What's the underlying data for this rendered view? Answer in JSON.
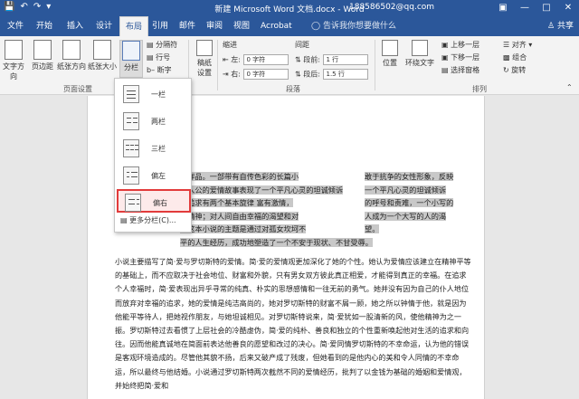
{
  "titlebar": {
    "title": "新建 Microsoft Word 文档.docx - Word",
    "account": "188586502@qq.com",
    "save_icon": "save-icon",
    "undo_icon": "undo-icon",
    "redo_icon": "redo-icon"
  },
  "tabs": [
    "文件",
    "开始",
    "插入",
    "设计",
    "布局",
    "引用",
    "邮件",
    "审阅",
    "视图",
    "Acrobat"
  ],
  "tab_active": "布局",
  "tellme": "告诉我你想要做什么",
  "share": "共享",
  "ribbon": {
    "page_setup": {
      "group_label": "页面设置",
      "text_direction": "文字方向",
      "margins": "页边距",
      "orientation": "纸张方向",
      "size": "纸张大小",
      "columns": "分栏",
      "breaks": "分隔符",
      "line_numbers": "行号",
      "hyphenation": "断字"
    },
    "manuscript": {
      "label": "稿纸设置",
      "line1": "稿纸",
      "line2": "设置"
    },
    "paragraph": {
      "group_label": "段落",
      "indent": "缩进",
      "spacing": "间距",
      "left": "左:",
      "right": "右:",
      "before": "段前:",
      "after": "段后:",
      "left_val": "0 字符",
      "right_val": "0 字符",
      "before_val": "1 行",
      "after_val": "1.5 行"
    },
    "arrange": {
      "group_label": "排列",
      "position": "位置",
      "wrap": "环绕文字",
      "forward": "上移一层",
      "backward": "下移一层",
      "selection": "选择窗格",
      "align": "对齐",
      "group": "组合",
      "rotate": "旋转"
    }
  },
  "columns_menu": {
    "items": [
      "一栏",
      "两栏",
      "三栏",
      "偏左",
      "偏右"
    ],
    "selected": "偏右",
    "more": "更多分栏(C)..."
  },
  "document": {
    "col1": [
      "的作品。一部带有自传色彩的长篇小",
      "主人公的爱情故事表现了一个平凡心灵的坦诚倾诉",
      "主追求有两个基本旋律 富有激情，",
      "的精神；对人间自由幸福的渴望和对",
      "。这本小说的主题是通过对孤女坎坷不",
      "平的人生经历，成功地塑造了一个不安于现状、不甘受辱。"
    ],
    "col2": [
      "敢于抗争的女性形象，反映",
      "一个平凡心灵的坦诚倾诉",
      "的呼号和责难，一个小写的",
      "人成为一个大写的人的渴",
      "望。"
    ],
    "body": "小说主要描写了简·爱与罗切斯特的爱情。简·爱的爱情观更加深化了她的个性。她认为爱情应该建立在精神平等的基础上，而不应取决于社会地位、财富和外貌，只有男女双方彼此真正相爱，才能得到真正的幸福。在追求个人幸福时，简·爱表现出异乎寻常的纯真、朴实的思想感情和一往无前的勇气。她并没有因为自己的仆人地位而放弃对幸福的追求，她的爱情是纯洁高尚的，她对罗切斯特的财富不屑一顾，她之所以钟情于他，就是因为他能平等待人，把她视作朋友，与她坦诚相见。对罗切斯特说来，简·爱犹如一股清新的风，使他精神为之一振。罗切斯特过去看惯了上层社会的冷酷虚伪，简·爱的纯朴、善良和独立的个性重新唤起他对生活的追求和向往。因而他能真诚地在简面前表达他善良的愿望和改过的决心。简·爱同情罗切斯特的不幸命运，认为他的错误是客观环境造成的。尽管他其貌不扬，后来又破产成了残废，但她看到的是他内心的美和令人同情的不幸命运，所以最终与他结婚。小说通过罗切斯特两次截然不同的爱情经历，批判了以金钱为基础的婚姻和爱情观，并始终把简·爱和"
  },
  "colors": {
    "accent": "#2b579a",
    "highlight": "#c8c8c8",
    "selection_border": "#e23b3b"
  }
}
